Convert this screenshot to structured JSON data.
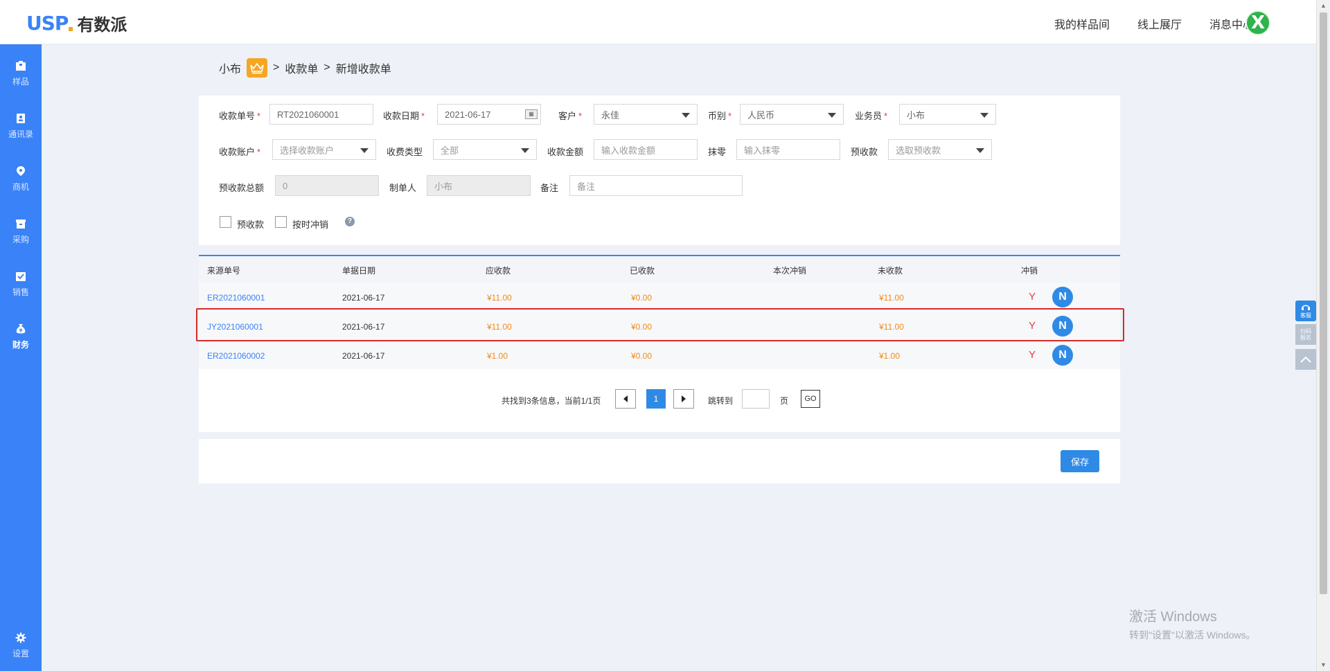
{
  "app": {
    "logo_text": "USP",
    "logo_cn": "有数派",
    "avatar_letter": "X"
  },
  "topnav": [
    "我的样品间",
    "线上展厅",
    "消息中心"
  ],
  "sidebar": {
    "items": [
      {
        "label": "样品",
        "icon": "sample-box-icon"
      },
      {
        "label": "通讯录",
        "icon": "contacts-icon"
      },
      {
        "label": "商机",
        "icon": "opportunity-pin-icon"
      },
      {
        "label": "采购",
        "icon": "purchase-box-icon"
      },
      {
        "label": "销售",
        "icon": "sales-check-icon"
      },
      {
        "label": "财务",
        "icon": "finance-bag-icon",
        "active": true
      }
    ],
    "settings_label": "设置"
  },
  "breadcrumb": {
    "user": "小布",
    "sep": ">",
    "level1": "收款单",
    "level2": "新增收款单"
  },
  "form": {
    "receipt_no": {
      "label": "收款单号",
      "value": "RT2021060001"
    },
    "receipt_date": {
      "label": "收款日期",
      "value": "2021-06-17"
    },
    "customer": {
      "label": "客户",
      "value": "永佳"
    },
    "currency": {
      "label": "币别",
      "value": "人民币"
    },
    "salesman": {
      "label": "业务员",
      "value": "小布"
    },
    "account": {
      "label": "收款账户",
      "placeholder": "选择收款账户"
    },
    "fee_type": {
      "label": "收费类型",
      "placeholder": "全部"
    },
    "amount": {
      "label": "收款金额",
      "placeholder": "输入收款金额"
    },
    "rounding": {
      "label": "抹零",
      "placeholder": "输入抹零"
    },
    "prepay": {
      "label": "预收款",
      "placeholder": "选取预收款"
    },
    "prepay_total": {
      "label": "预收款总额",
      "value": "0"
    },
    "creator": {
      "label": "制单人",
      "value": "小布"
    },
    "remark": {
      "label": "备注",
      "placeholder": "备注"
    },
    "check_prepay": "预收款",
    "check_offset": "按时冲销",
    "help_symbol": "?"
  },
  "table": {
    "headers": [
      "来源单号",
      "单据日期",
      "应收款",
      "已收款",
      "本次冲销",
      "未收款",
      "冲销"
    ],
    "rows": [
      {
        "source": "ER2021060001",
        "date": "2021-06-17",
        "receivable": "¥11.00",
        "received": "¥0.00",
        "offset": "",
        "unreceived": "¥11.00",
        "flag": "Y",
        "btn": "N"
      },
      {
        "source": "JY2021060001",
        "date": "2021-06-17",
        "receivable": "¥11.00",
        "received": "¥0.00",
        "offset": "",
        "unreceived": "¥11.00",
        "flag": "Y",
        "btn": "N"
      },
      {
        "source": "ER2021060002",
        "date": "2021-06-17",
        "receivable": "¥1.00",
        "received": "¥0.00",
        "offset": "",
        "unreceived": "¥1.00",
        "flag": "Y",
        "btn": "N"
      }
    ]
  },
  "pager": {
    "summary": "共找到3条信息，当前1/1页",
    "current": "1",
    "jump_label": "跳转到",
    "page_unit": "页",
    "go": "GO"
  },
  "save_label": "保存",
  "float_widgets": {
    "service": "客服",
    "scan": "扫码\n报名"
  },
  "watermark": {
    "line1": "激活 Windows",
    "line2": "转到\"设置\"以激活 Windows。"
  },
  "colors": {
    "primary": "#3a82f7",
    "amount": "#f08a18",
    "flag": "#e73c3c",
    "highlight": "#d62a2a"
  }
}
